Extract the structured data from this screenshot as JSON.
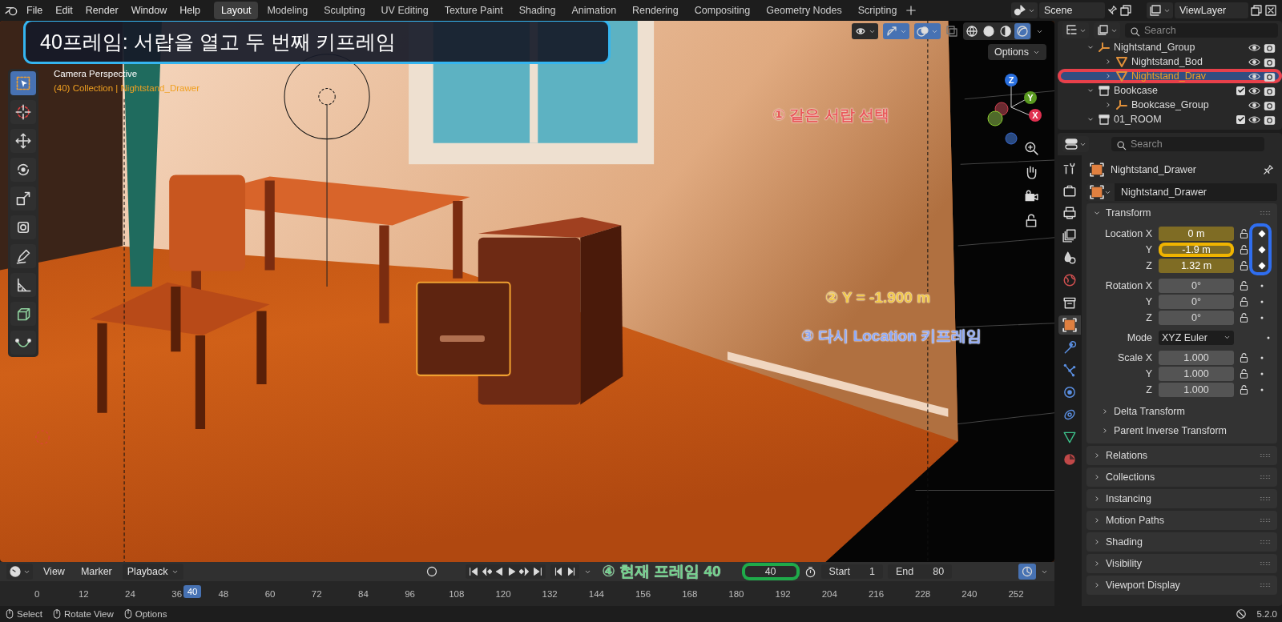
{
  "topbar": {
    "menu": [
      "File",
      "Edit",
      "Render",
      "Window",
      "Help"
    ],
    "workspaces": [
      {
        "label": "Layout",
        "selected": true
      },
      {
        "label": "Modeling",
        "selected": false
      },
      {
        "label": "Sculpting",
        "selected": false
      },
      {
        "label": "UV Editing",
        "selected": false
      },
      {
        "label": "Texture Paint",
        "selected": false
      },
      {
        "label": "Shading",
        "selected": false
      },
      {
        "label": "Animation",
        "selected": false
      },
      {
        "label": "Rendering",
        "selected": false
      },
      {
        "label": "Compositing",
        "selected": false
      },
      {
        "label": "Geometry Nodes",
        "selected": false
      },
      {
        "label": "Scripting",
        "selected": false
      }
    ],
    "scene": "Scene",
    "view_layer": "ViewLayer"
  },
  "viewport": {
    "banner": "40프레임: 서랍을 열고 두 번째 키프레임",
    "options": "Options",
    "camera_label": "Camera Perspective",
    "object_label": "(40) Collection | Nightstand_Drawer",
    "tools": [
      {
        "kind": "select",
        "selected": true
      },
      {
        "kind": "cursor",
        "selected": false
      },
      {
        "kind": "move",
        "selected": false
      },
      {
        "kind": "rotate",
        "selected": false
      },
      {
        "kind": "scale",
        "selected": false
      },
      {
        "kind": "transform",
        "selected": false
      },
      {
        "kind": "annotate",
        "selected": false
      },
      {
        "kind": "measure",
        "selected": false
      },
      {
        "kind": "add-cube",
        "selected": false
      },
      {
        "kind": "curve",
        "selected": false
      }
    ],
    "shading_modes": [
      {
        "kind": "wireframe",
        "selected": false
      },
      {
        "kind": "solid",
        "selected": false
      },
      {
        "kind": "material",
        "selected": false
      },
      {
        "kind": "rendered",
        "selected": true
      }
    ],
    "gizmo_axes": [
      "Z",
      "Y",
      "X"
    ],
    "notes": [
      {
        "text": "① 같은 서랍 선택",
        "color": "#e85a5a"
      },
      {
        "text": "② Y = -1.900 m",
        "color": "#f2c84a"
      },
      {
        "text": "③ 다시 Location 키프레임",
        "color": "#8fa8f5"
      }
    ]
  },
  "outliner": {
    "search_placeholder": "Search",
    "tree": [
      {
        "kind": "group",
        "label": "Nightstand_Group",
        "expanded": true,
        "selected": false,
        "highlight": false,
        "children": [
          {
            "kind": "mesh",
            "label": "Nightstand_Bod",
            "expanded": false,
            "selected": false,
            "highlight": false
          },
          {
            "kind": "mesh",
            "label": "Nightstand_Drav",
            "expanded": false,
            "selected": true,
            "highlight": true
          }
        ]
      },
      {
        "kind": "collection",
        "label": "Bookcase",
        "expanded": true,
        "checked": true,
        "selected": false,
        "highlight": false,
        "children": [
          {
            "kind": "group",
            "label": "Bookcase_Group",
            "expanded": false,
            "selected": false,
            "highlight": false
          }
        ]
      },
      {
        "kind": "collection",
        "label": "01_ROOM",
        "expanded": true,
        "checked": true,
        "selected": false,
        "highlight": false
      }
    ]
  },
  "properties": {
    "search_placeholder": "Search",
    "tabs": [
      {
        "kind": "tool",
        "selected": false
      },
      {
        "kind": "render",
        "selected": false
      },
      {
        "kind": "output",
        "selected": false
      },
      {
        "kind": "view-layer",
        "selected": false
      },
      {
        "kind": "scene",
        "selected": false
      },
      {
        "kind": "world",
        "selected": false
      },
      {
        "kind": "collection",
        "selected": false
      },
      {
        "kind": "object",
        "selected": true
      },
      {
        "kind": "modifiers",
        "selected": false
      },
      {
        "kind": "particles",
        "selected": false
      },
      {
        "kind": "physics",
        "selected": false
      },
      {
        "kind": "constraints",
        "selected": false
      },
      {
        "kind": "data",
        "selected": false
      },
      {
        "kind": "material",
        "selected": false
      }
    ],
    "object_name": "Nightstand_Drawer",
    "datablock": "Nightstand_Drawer",
    "transform": {
      "title": "Transform",
      "expanded": true,
      "groups": [
        {
          "keys_highlighted": true,
          "rows": [
            {
              "kind": "number",
              "label": "Location X",
              "value": "0 m",
              "keyed": true,
              "highlight": false
            },
            {
              "kind": "number",
              "label": "Y",
              "value": "-1.9 m",
              "keyed": true,
              "highlight": true
            },
            {
              "kind": "number",
              "label": "Z",
              "value": "1.32 m",
              "keyed": true,
              "highlight": false
            }
          ]
        },
        {
          "keys_highlighted": false,
          "rows": [
            {
              "kind": "number",
              "label": "Rotation X",
              "value": "0°",
              "keyed": false,
              "highlight": false
            },
            {
              "kind": "number",
              "label": "Y",
              "value": "0°",
              "keyed": false,
              "highlight": false
            },
            {
              "kind": "number",
              "label": "Z",
              "value": "0°",
              "keyed": false,
              "highlight": false
            }
          ]
        },
        {
          "keys_highlighted": false,
          "rows": [
            {
              "kind": "menu",
              "label": "Mode",
              "value": "XYZ Euler",
              "keyed": false,
              "highlight": false
            }
          ]
        },
        {
          "keys_highlighted": false,
          "rows": [
            {
              "kind": "number",
              "label": "Scale X",
              "value": "1.000",
              "keyed": false,
              "highlight": false
            },
            {
              "kind": "number",
              "label": "Y",
              "value": "1.000",
              "keyed": false,
              "highlight": false
            },
            {
              "kind": "number",
              "label": "Z",
              "value": "1.000",
              "keyed": false,
              "highlight": false
            }
          ]
        }
      ],
      "subpanels": [
        {
          "label": "Delta Transform",
          "expanded": false
        },
        {
          "label": "Parent Inverse Transform",
          "expanded": false
        }
      ]
    },
    "panels": [
      {
        "label": "Relations",
        "expanded": false
      },
      {
        "label": "Collections",
        "expanded": false
      },
      {
        "label": "Instancing",
        "expanded": false
      },
      {
        "label": "Motion Paths",
        "expanded": false
      },
      {
        "label": "Shading",
        "expanded": false
      },
      {
        "label": "Visibility",
        "expanded": false
      },
      {
        "label": "Viewport Display",
        "expanded": false
      }
    ]
  },
  "timeline": {
    "menu": [
      "View",
      "Marker",
      "Playback"
    ],
    "note": {
      "text": "④ 현재 프레임 40",
      "color": "#6fd08a"
    },
    "current_frame": "40",
    "frame_highlighted": true,
    "start_label": "Start",
    "start": "1",
    "end_label": "End",
    "end": "80",
    "ruler": [
      "0",
      "12",
      "24",
      "36",
      "48",
      "60",
      "72",
      "84",
      "96",
      "108",
      "120",
      "132",
      "144",
      "156",
      "168",
      "180",
      "192",
      "204",
      "216",
      "228",
      "240",
      "252"
    ],
    "playhead": "40"
  },
  "status_bar": {
    "items": [
      "Select",
      "Rotate View",
      "Options"
    ],
    "version": "5.2.0"
  }
}
